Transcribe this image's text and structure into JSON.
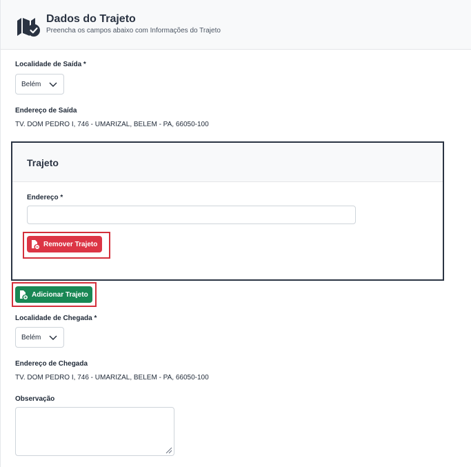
{
  "header": {
    "title": "Dados do Trajeto",
    "subtitle": "Preencha os campos abaixo com Informações do Trajeto",
    "icon": "route-check-icon"
  },
  "saida": {
    "localidade_label": "Localidade de Saída *",
    "localidade_value": "Belém",
    "endereco_label": "Endereço de Saída",
    "endereco_value": "TV. DOM PEDRO I, 746 - UMARIZAL, BELEM - PA, 66050-100"
  },
  "trajeto": {
    "title": "Trajeto",
    "endereco_label": "Endereço *",
    "endereco_value": "",
    "remover_label": "Remover Trajeto"
  },
  "adicionar_label": "Adicionar Trajeto",
  "chegada": {
    "localidade_label": "Localidade de Chegada *",
    "localidade_value": "Belém",
    "endereco_label": "Endereço de Chegada",
    "endereco_value": "TV. DOM PEDRO I, 746 - UMARIZAL, BELEM - PA, 66050-100"
  },
  "observacao": {
    "label": "Observação",
    "value": ""
  },
  "colors": {
    "danger": "#dc3545",
    "success": "#198754",
    "highlight": "#d32f3a",
    "dark": "#2a3342"
  }
}
